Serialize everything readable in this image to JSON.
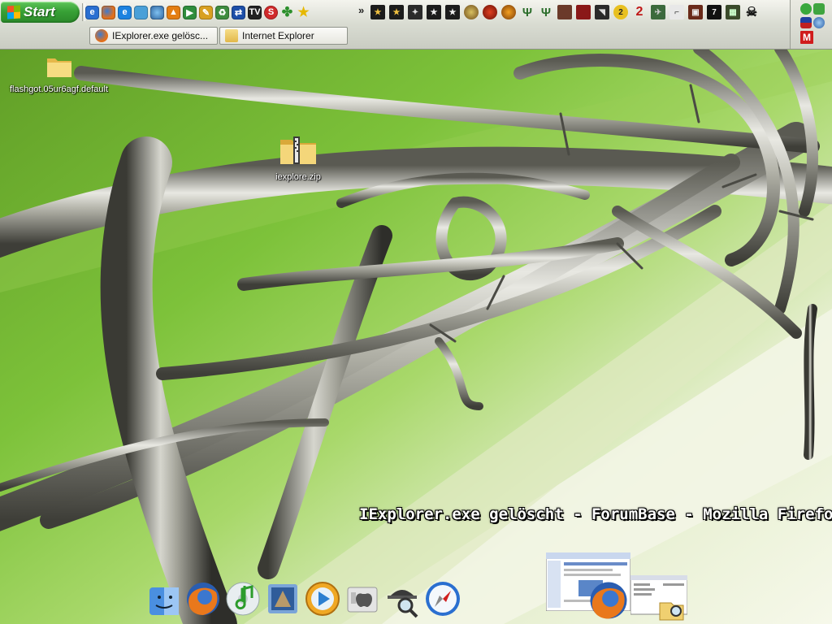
{
  "taskbar": {
    "start_label": "Start",
    "quicklaunch_icons": [
      "ie-e-icon",
      "firefox-icon",
      "ie-icon",
      "glass-icon",
      "globe-icon",
      "cone-icon",
      "media-icon",
      "pen-icon",
      "recycle-icon",
      "arrows-icon",
      "tv-icon",
      "skype-icon",
      "clover-icon",
      "star-icon"
    ],
    "overflow_chevron": "»",
    "tray_icons": [
      "game-icon-1",
      "game-icon-2",
      "game-icon-3",
      "game-icon-4",
      "game-icon-5",
      "game-icon-6",
      "game-icon-7",
      "game-icon-8",
      "game-icon-9",
      "game-icon-10",
      "game-icon-11",
      "game-icon-12",
      "game-icon-13",
      "game-icon-14",
      "game-icon-15",
      "game-icon-16",
      "game-icon-17",
      "game-icon-18",
      "game-icon-19",
      "game-icon-20",
      "game-icon-21"
    ],
    "tray_text": {
      "badge_two": "2",
      "big_two": "2",
      "tv_text": "TV",
      "hl_text": "7"
    },
    "tasks": [
      {
        "label": "IExplorer.exe gelösc...",
        "icon": "firefox-icon"
      },
      {
        "label": "Internet Explorer",
        "icon": "folder-icon"
      }
    ],
    "right_panel": {
      "m_label": "M"
    }
  },
  "desktop": {
    "icons": [
      {
        "label": "flashgot.05ur6agf.default",
        "icon": "folder-icon"
      },
      {
        "label": "iexplore.zip",
        "icon": "zip-folder-icon"
      }
    ]
  },
  "window_title": "IExplorer.exe gelöscht - ForumBase - Mozilla Firefox",
  "dock": {
    "icons": [
      "finder-icon",
      "firefox-icon",
      "itunes-icon",
      "mail-icon",
      "quicktime-icon",
      "apple-icon",
      "sherlock-icon",
      "safari-icon"
    ],
    "minimized": [
      "window-thumbnail",
      "firefox-icon",
      "explorer-thumbnail"
    ]
  },
  "colors": {
    "start_green": "#38a136",
    "wallpaper_green": "#6fae2a",
    "wallpaper_light": "#eef2dc",
    "taskbar": "#d9dcd2"
  }
}
